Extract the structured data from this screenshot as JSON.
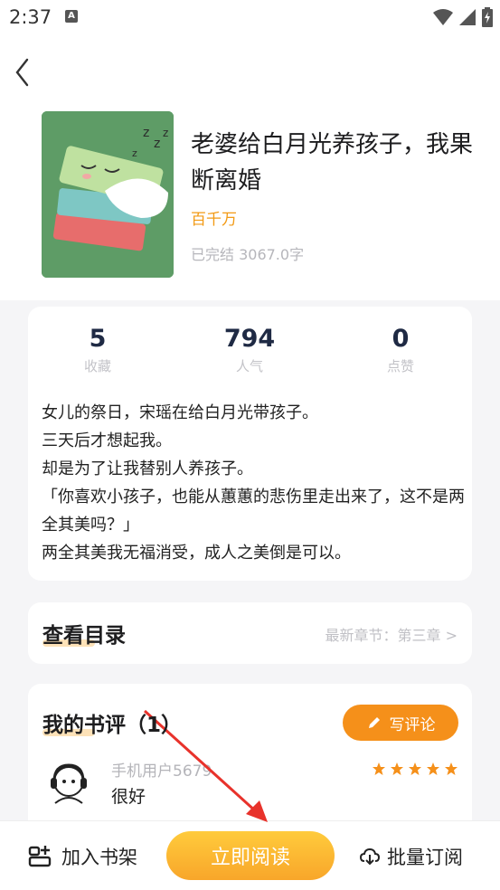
{
  "status_bar": {
    "time": "2:37",
    "notification_icon_label": "A"
  },
  "book": {
    "title": "老婆给白月光养孩子，我果断离婚",
    "author": "百千万",
    "meta": "已完结 3067.0字"
  },
  "stats": [
    {
      "value": "5",
      "label": "收藏"
    },
    {
      "value": "794",
      "label": "人气"
    },
    {
      "value": "0",
      "label": "点赞"
    }
  ],
  "description": [
    "女儿的祭日，宋瑶在给白月光带孩子。",
    "三天后才想起我。",
    "却是为了让我替别人养孩子。",
    "「你喜欢小孩子，也能从蕙蕙的悲伤里走出来了，这不是两全其美吗？」",
    "两全其美我无福消受，成人之美倒是可以。"
  ],
  "toc": {
    "title": "查看目录",
    "latest": "最新章节：第三章 >"
  },
  "reviews": {
    "title": "我的书评（1）",
    "write_label": "写评论",
    "items": [
      {
        "user": "手机用户5679",
        "text": "很好",
        "rating": 5
      }
    ]
  },
  "bottom_bar": {
    "shelf_label": "加入书架",
    "read_label": "立即阅读",
    "batch_label": "批量订阅"
  },
  "colors": {
    "accent": "#f5901a",
    "author": "#f29a14",
    "annotation_arrow": "#e8322b"
  }
}
